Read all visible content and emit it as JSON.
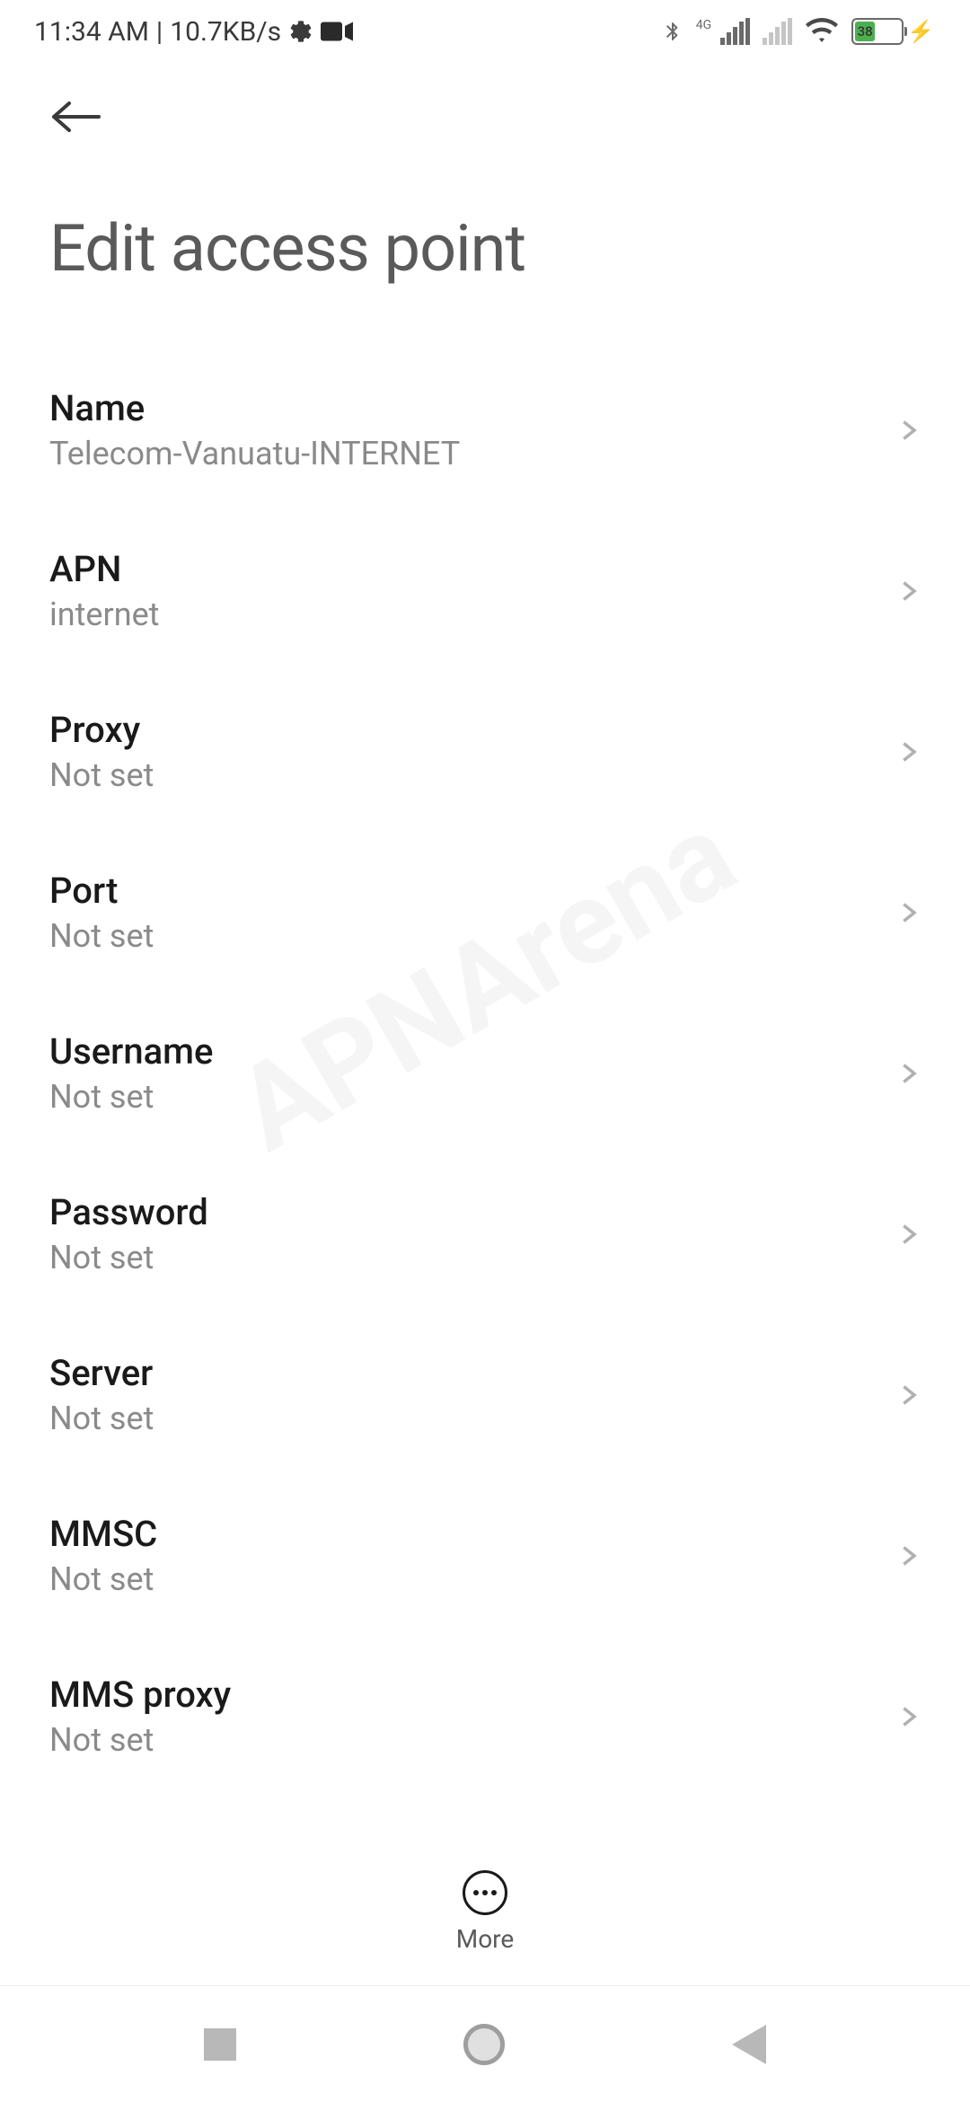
{
  "status_bar": {
    "time": "11:34 AM",
    "data_rate": "10.7KB/s",
    "battery_percent": "38",
    "signal_label": "4G"
  },
  "page": {
    "title": "Edit access point"
  },
  "settings": [
    {
      "label": "Name",
      "value": "Telecom-Vanuatu-INTERNET"
    },
    {
      "label": "APN",
      "value": "internet"
    },
    {
      "label": "Proxy",
      "value": "Not set"
    },
    {
      "label": "Port",
      "value": "Not set"
    },
    {
      "label": "Username",
      "value": "Not set"
    },
    {
      "label": "Password",
      "value": "Not set"
    },
    {
      "label": "Server",
      "value": "Not set"
    },
    {
      "label": "MMSC",
      "value": "Not set"
    },
    {
      "label": "MMS proxy",
      "value": "Not set"
    }
  ],
  "bottom_action": {
    "label": "More"
  },
  "watermark": "APNArena"
}
